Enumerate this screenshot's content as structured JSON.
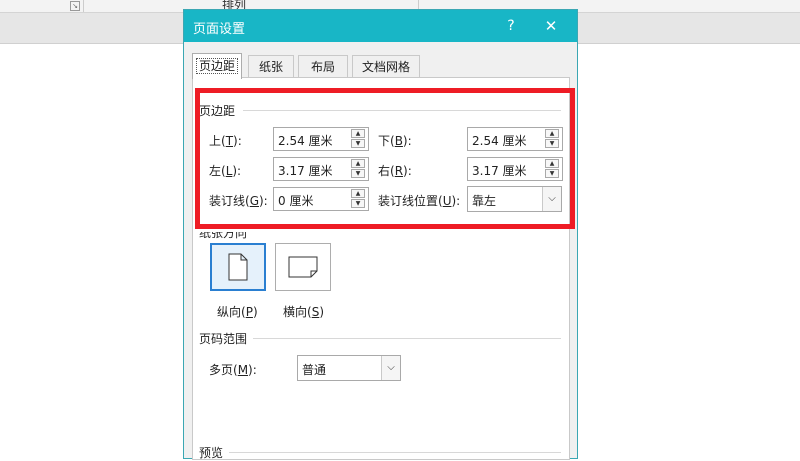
{
  "background": {
    "group_label": "排列",
    "launcher_glyph": "↘"
  },
  "dialog": {
    "title": "页面设置",
    "help_glyph": "?",
    "close_glyph": "✕",
    "tabs": [
      {
        "label": "页边距",
        "active": true
      },
      {
        "label": "纸张",
        "active": false
      },
      {
        "label": "布局",
        "active": false
      },
      {
        "label": "文档网格",
        "active": false
      }
    ]
  },
  "margins": {
    "section_title": "页边距",
    "top": {
      "label": "上(",
      "key": "T",
      "suffix": "):",
      "value": "2.54 厘米"
    },
    "bottom": {
      "label": "下(",
      "key": "B",
      "suffix": "):",
      "value": "2.54 厘米"
    },
    "left": {
      "label": "左(",
      "key": "L",
      "suffix": "):",
      "value": "3.17 厘米"
    },
    "right": {
      "label": "右(",
      "key": "R",
      "suffix": "):",
      "value": "3.17 厘米"
    },
    "gutter": {
      "label": "装订线(",
      "key": "G",
      "suffix": "):",
      "value": "0 厘米"
    },
    "gutter_position": {
      "label": "装订线位置(",
      "key": "U",
      "suffix": "):",
      "value": "靠左"
    }
  },
  "orientation": {
    "section_title": "纸张方向",
    "portrait": {
      "label": "纵向(",
      "key": "P",
      "suffix": ")",
      "selected": true
    },
    "landscape": {
      "label": "横向(",
      "key": "S",
      "suffix": ")",
      "selected": false
    }
  },
  "pages": {
    "section_title": "页码范围",
    "multiple": {
      "label": "多页(",
      "key": "M",
      "suffix": "):",
      "value": "普通"
    }
  },
  "preview": {
    "section_title": "预览"
  },
  "colors": {
    "titlebar": "#18b6c6",
    "highlight": "#ee1c25",
    "selected_border": "#2a7fd1"
  }
}
